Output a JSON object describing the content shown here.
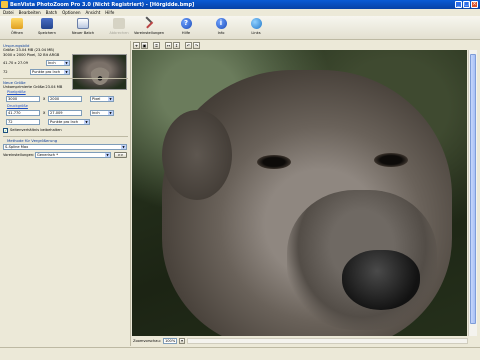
{
  "window": {
    "title": "BenVista PhotoZoom Pro 3.0 (Nicht Registriert) - [Hörgidde.bmp]",
    "controls": [
      "_",
      "□",
      "×"
    ]
  },
  "menu": [
    "Datei",
    "Bearbeiten",
    "Batch",
    "Optionen",
    "Ansicht",
    "Hilfe"
  ],
  "toolbar": {
    "open": "Öffnen",
    "save": "Speichern",
    "new_batch": "Neuer Batch",
    "disabled": "Abbrechen",
    "settings": "Voreinstellungen",
    "help": "Hilfe",
    "info": "Info",
    "links": "Links"
  },
  "original": {
    "heading": "Ursprungsbild",
    "size": "Größe: 23.04 MB (23.04 MB)",
    "dims": "3000 x 2000 Pixel, 32 Bit ARGB",
    "print_size": "41.70 x 27.09",
    "print_unit": "Inch",
    "res_value": "72",
    "res_unit": "Punkte pro Inch"
  },
  "new_size": {
    "heading": "Neue Größe",
    "uncompressed": "Unkomprimierte Größe:23.04 MB",
    "pixel_label": "Pixelgröße",
    "width_px": "3000",
    "height_px": "2000",
    "px_unit": "Pixel",
    "print_label": "Druckgröße",
    "width_in": "41.770",
    "height_in": "27.009",
    "in_unit": "Inch",
    "res": "72",
    "res_unit": "Punkte pro Inch",
    "keep_ratio": "Seitenverhältnis beibehalten",
    "times": "x"
  },
  "method": {
    "heading": "Methode für Vergrößerung",
    "value": "S-Spline Max",
    "preset_label": "Voreinstellungen:",
    "preset_value": "Generisch *",
    "more": ">>"
  },
  "viewer": {
    "zoom_label": "Zoomvorschau:",
    "zoom_value": "100%"
  }
}
